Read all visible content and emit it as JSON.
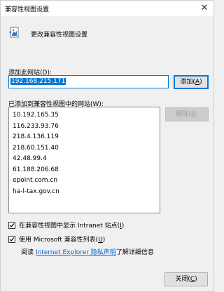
{
  "window": {
    "title": "兼容性视图设置",
    "close_glyph": "✕"
  },
  "header": {
    "text": "更改兼容性视图设置"
  },
  "add_section": {
    "label_prefix": "添加此网站(",
    "label_key": "D",
    "label_suffix": "):",
    "input_value": "192.168.215.171",
    "add_button_prefix": "添加(",
    "add_button_key": "A",
    "add_button_suffix": ")"
  },
  "list_section": {
    "label_prefix": "已添加到兼容性视图中的网站(",
    "label_key": "W",
    "label_suffix": "):",
    "items": [
      "10.192.165.35",
      "116.233.93.76",
      "218.4.136.119",
      "218.60.151.40",
      "42.48.99.4",
      "61.188.206.68",
      "epoint.com.cn",
      "ha-l-tax.gov.cn"
    ],
    "remove_button_prefix": "删除(",
    "remove_button_key": "R",
    "remove_button_suffix": ")"
  },
  "options": {
    "intranet_prefix": "在兼容性视图中显示 Intranet 站点(",
    "intranet_key": "I",
    "intranet_suffix": ")",
    "intranet_checked": true,
    "mslist_prefix": "使用 Microsoft 兼容性列表(",
    "mslist_key": "U",
    "mslist_suffix": ")",
    "mslist_checked": true
  },
  "info": {
    "prefix": "阅读 ",
    "link_text": "Internet Explorer 隐私声明",
    "suffix": "了解详细信息"
  },
  "footer": {
    "close_prefix": "关闭(",
    "close_key": "C",
    "close_suffix": ")"
  },
  "colors": {
    "accent": "#0078d7",
    "link": "#0066cc",
    "background": "#f0f0f0"
  }
}
